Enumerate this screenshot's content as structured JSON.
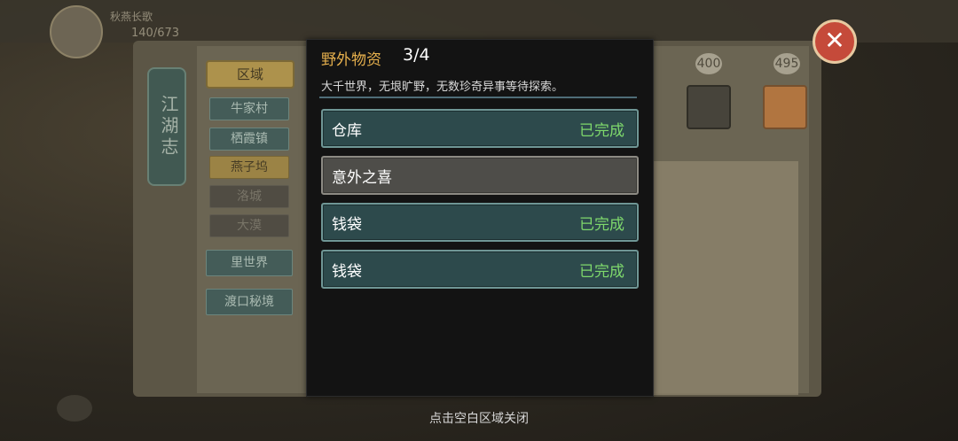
{
  "dialog": {
    "title": "野外物资",
    "count": "3/4",
    "description": "大千世界，无垠旷野，无数珍奇异事等待探索。",
    "items": [
      {
        "label": "仓库",
        "status": "已完成"
      },
      {
        "label": "意外之喜",
        "status": ""
      },
      {
        "label": "钱袋",
        "status": "已完成"
      },
      {
        "label": "钱袋",
        "status": "已完成"
      }
    ]
  },
  "hint": "点击空白区域关闭",
  "background": {
    "hud_name": "秋燕长歌",
    "hud_hp": "140/673",
    "book_title": "江湖志",
    "region_tab": "区域",
    "locations": [
      "牛家村",
      "栖霞镇",
      "燕子坞",
      "洛城",
      "大漠"
    ],
    "extra_buttons": [
      "里世界",
      "渡口秘境"
    ],
    "scores": [
      "400",
      "495"
    ]
  },
  "colors": {
    "title": "#e6b04d",
    "complete": "#7ed86c",
    "row_done": "#2d4a4c",
    "row_todo": "#4e4d49"
  }
}
